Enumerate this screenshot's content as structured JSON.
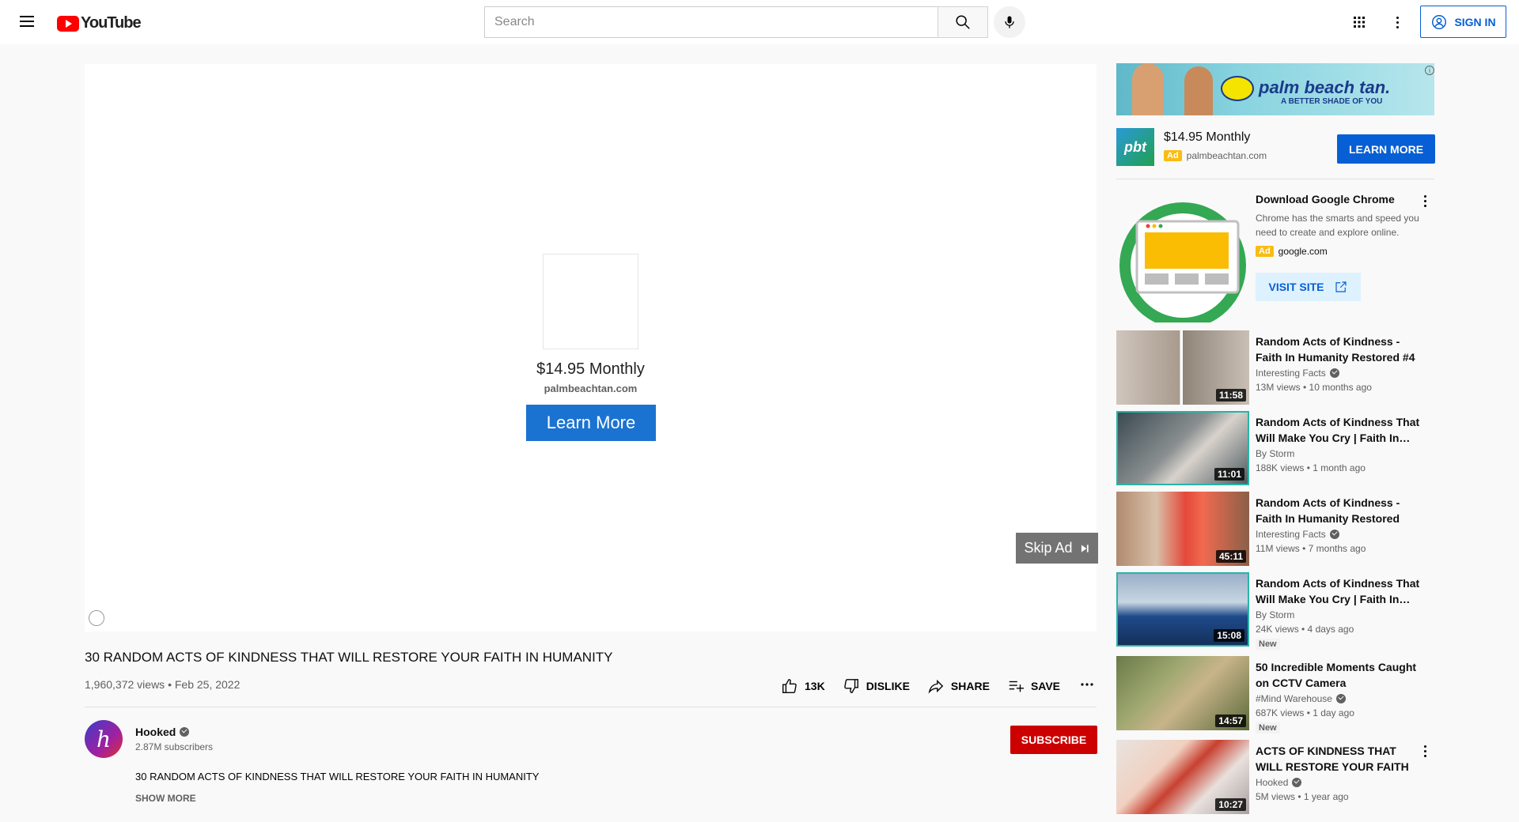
{
  "masthead": {
    "logo_text": "YouTube",
    "search_placeholder": "Search",
    "signin_label": "SIGN IN"
  },
  "player": {
    "ad_price": "$14.95 Monthly",
    "ad_domain": "palmbeachtan.com",
    "ad_cta": "Learn More",
    "skip_label": "Skip Ad"
  },
  "video": {
    "title": "30 RANDOM ACTS OF KINDNESS THAT WILL RESTORE YOUR FAITH IN HUMANITY",
    "meta": "1,960,372 views • Feb 25, 2022",
    "likes": "13K",
    "dislike_label": "DISLIKE",
    "share_label": "SHARE",
    "save_label": "SAVE"
  },
  "channel": {
    "name": "Hooked",
    "subscribers": "2.87M subscribers",
    "subscribe_label": "SUBSCRIBE",
    "description": "30 RANDOM ACTS OF KINDNESS THAT WILL RESTORE YOUR FAITH IN HUMANITY",
    "show_more": "SHOW MORE"
  },
  "sidebar_ad": {
    "banner_brand": "palm beach tan.",
    "banner_tagline": "A BETTER SHADE OF YOU",
    "logo_text": "pbt",
    "price": "$14.95 Monthly",
    "ad_badge": "Ad",
    "domain": "palmbeachtan.com",
    "cta": "LEARN MORE"
  },
  "chrome_ad": {
    "title": "Download Google Chrome",
    "description": "Chrome has the smarts and speed you need to create and explore online.",
    "ad_badge": "Ad",
    "domain": "google.com",
    "cta": "VISIT SITE"
  },
  "recommendations": [
    {
      "title": "Random Acts of Kindness - Faith In Humanity Restored #4",
      "channel": "Interesting Facts",
      "verified": true,
      "meta": "13M views • 10 months ago",
      "duration": "11:58",
      "badge": ""
    },
    {
      "title": "Random Acts of Kindness That Will Make You Cry  | Faith In…",
      "channel": "By Storm",
      "verified": false,
      "meta": "188K views • 1 month ago",
      "duration": "11:01",
      "badge": ""
    },
    {
      "title": "Random Acts of Kindness - Faith In Humanity Restored",
      "channel": "Interesting Facts",
      "verified": true,
      "meta": "11M views • 7 months ago",
      "duration": "45:11",
      "badge": ""
    },
    {
      "title": "Random Acts of Kindness That Will Make You Cry  | Faith In…",
      "channel": "By Storm",
      "verified": false,
      "meta": "24K views • 4 days ago",
      "duration": "15:08",
      "badge": "New"
    },
    {
      "title": "50 Incredible Moments Caught on CCTV Camera",
      "channel": "#Mind Warehouse",
      "verified": true,
      "meta": "687K views • 1 day ago",
      "duration": "14:57",
      "badge": "New"
    },
    {
      "title": "ACTS OF KINDNESS THAT WILL RESTORE YOUR FAITH IN…",
      "channel": "Hooked",
      "verified": true,
      "meta": "5M views • 1 year ago",
      "duration": "10:27",
      "badge": ""
    }
  ],
  "colors": {
    "brand_red": "#ff0000",
    "link_blue": "#065fd4",
    "subscribe_red": "#cc0000",
    "ad_yellow": "#f9bc12"
  }
}
